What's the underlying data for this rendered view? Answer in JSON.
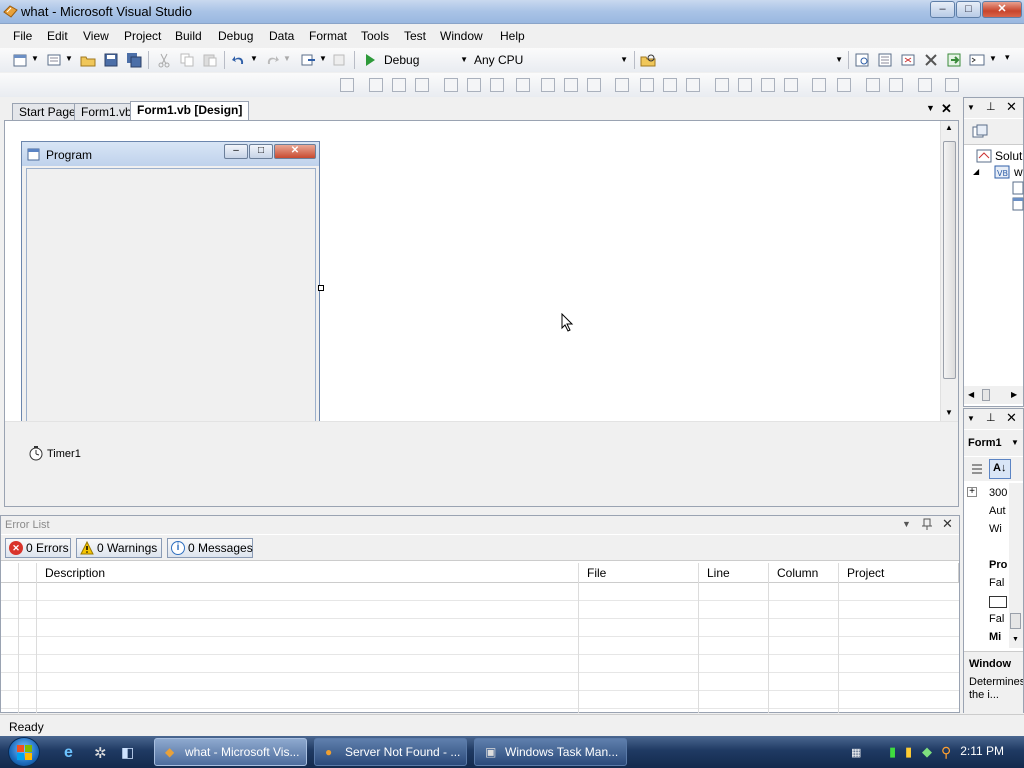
{
  "window": {
    "title": "what - Microsoft Visual Studio",
    "minimize": "–",
    "maximize": "□",
    "close": "✕"
  },
  "menu": [
    "File",
    "Edit",
    "View",
    "Project",
    "Build",
    "Debug",
    "Data",
    "Format",
    "Tools",
    "Test",
    "Window",
    "Help"
  ],
  "toolbar": {
    "config": "Debug",
    "platform": "Any CPU"
  },
  "doc_tabs": [
    "Start Page",
    "Form1.vb",
    "Form1.vb [Design]"
  ],
  "form": {
    "caption": "Program"
  },
  "tray": {
    "component": "Timer1"
  },
  "error_list": {
    "title": "Error List",
    "errors": "0 Errors",
    "warnings": "0 Warnings",
    "messages": "0 Messages",
    "columns": [
      "Description",
      "File",
      "Line",
      "Column",
      "Project"
    ]
  },
  "solution": {
    "root": "Solut",
    "project": "w"
  },
  "properties": {
    "object": "Form1",
    "rows": [
      "300",
      "Aut",
      "Wi",
      "",
      "Pro",
      "Fal",
      "",
      "Fal",
      "Mi"
    ],
    "desc_title": "Window",
    "desc_text": "Determines the i..."
  },
  "status": "Ready",
  "taskbar": {
    "tasks": [
      "what - Microsoft Vis...",
      "Server Not Found - ...",
      "Windows Task Man..."
    ],
    "clock": "2:11 PM"
  },
  "colors": {
    "accent": "#3b6fb6",
    "taskbar": "#1f3a63",
    "error": "#d9342b",
    "warning": "#f5c400",
    "info": "#2f6fbf"
  }
}
